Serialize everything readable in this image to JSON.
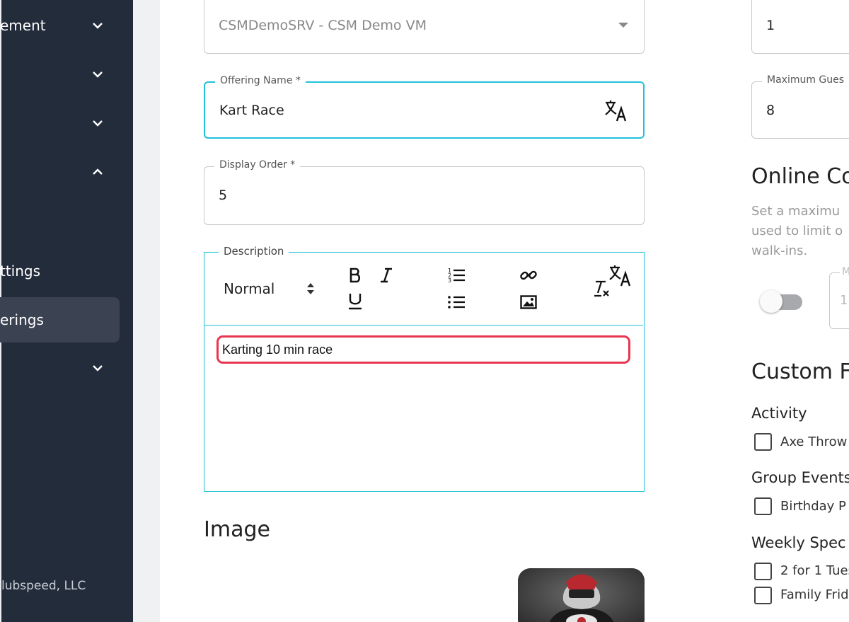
{
  "sidebar": {
    "items": [
      {
        "label": "ement",
        "chevron": "chevron-down"
      },
      {
        "label": "",
        "chevron": "chevron-down"
      },
      {
        "label": "",
        "chevron": "chevron-down"
      },
      {
        "label": "",
        "chevron": "chevron-up"
      },
      {
        "label": "ttings",
        "chevron": ""
      },
      {
        "label": "erings",
        "chevron": ""
      },
      {
        "label": "",
        "chevron": "chevron-down"
      }
    ],
    "footer": "lubspeed, LLC",
    "bg_color": "#232c3b",
    "active_color": "#3b4352"
  },
  "form": {
    "location_select": {
      "value": "CSMDemoSRV - CSM Demo VM",
      "icon": "caret-down-icon"
    },
    "offering_name": {
      "label": "Offering Name *",
      "value": "Kart Race",
      "icon": "translate-icon"
    },
    "display_order": {
      "label": "Display Order *",
      "value": "5"
    },
    "description": {
      "label": "Description",
      "format_select": "Normal",
      "toolbar": [
        "bold-icon",
        "italic-icon",
        "underline-icon",
        "ordered-list-icon",
        "bullet-list-icon",
        "link-icon",
        "image-icon",
        "clear-format-icon",
        "translate-icon"
      ],
      "content": "Karting 10 min race"
    },
    "image_title": "Image"
  },
  "right": {
    "top_field_value": "1",
    "max_guests": {
      "label": "Maximum Gues",
      "value": "8"
    },
    "online_title": "Online Co",
    "online_help": "Set a maximu used to limit o walk-ins.",
    "small_field_label": "M",
    "small_field_value": "1",
    "custom_title": "Custom F",
    "groups": [
      {
        "title": "Activity",
        "options": [
          "Axe Throw"
        ]
      },
      {
        "title": "Group Events",
        "options": [
          "Birthday P"
        ]
      },
      {
        "title": "Weekly Spec",
        "options": [
          "2 for 1 Tues",
          "Family Frid"
        ]
      }
    ]
  },
  "colors": {
    "accent": "#21c2d9",
    "highlight": "#e8364f"
  }
}
